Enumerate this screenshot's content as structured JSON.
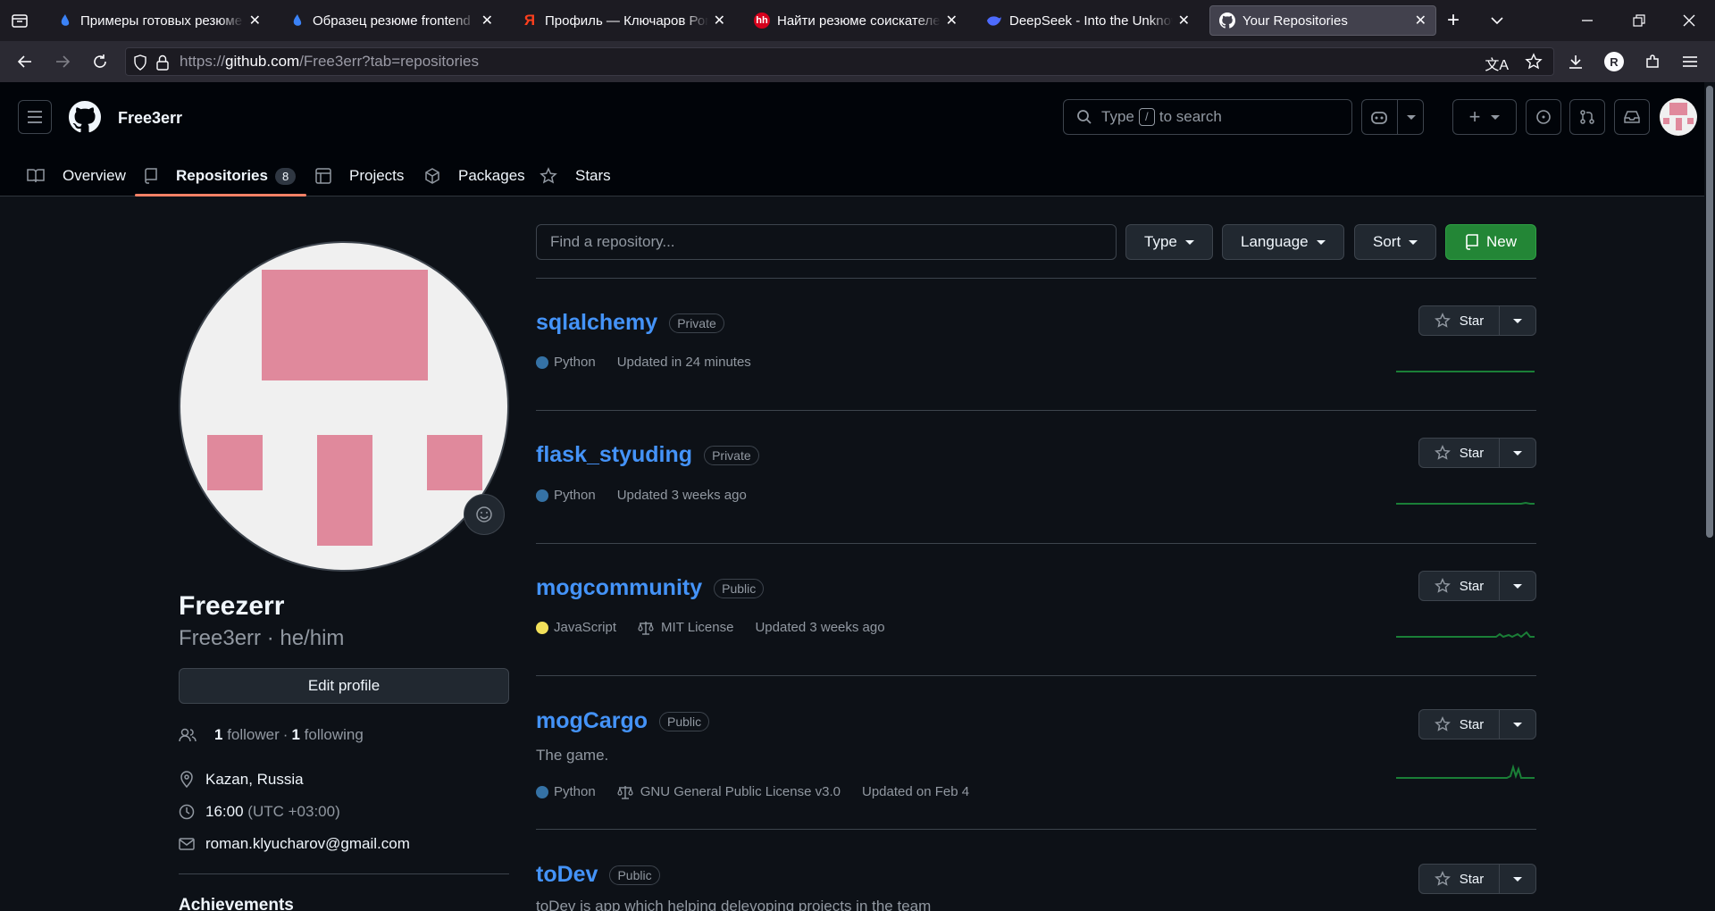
{
  "browser": {
    "tabs": [
      {
        "title": "Примеры готовых резюме",
        "favicon": "drop-icon",
        "color": "#3b82f6"
      },
      {
        "title": "Образец резюме frontend",
        "favicon": "drop-icon",
        "color": "#3b82f6"
      },
      {
        "title": "Профиль — Ключаров Ром",
        "favicon": "Я",
        "color": "#fc3f1d"
      },
      {
        "title": "Найти резюме соискателей",
        "favicon": "hh",
        "color": "#d6001c"
      },
      {
        "title": "DeepSeek - Into the Unknow",
        "favicon": "whale-icon",
        "color": "#4d6bfe"
      },
      {
        "title": "Your Repositories",
        "favicon": "github-icon",
        "color": "#ffffff"
      }
    ],
    "url_prefix": "https://",
    "url_host": "github.com",
    "url_path": "/Free3err?tab=repositories"
  },
  "header": {
    "username": "Free3err",
    "search_before": "Type",
    "search_key": "/",
    "search_after": "to search"
  },
  "profile_tabs": [
    {
      "label": "Overview",
      "icon": "book-icon"
    },
    {
      "label": "Repositories",
      "icon": "repo-icon",
      "count": "8",
      "selected": true
    },
    {
      "label": "Projects",
      "icon": "table-icon"
    },
    {
      "label": "Packages",
      "icon": "package-icon"
    },
    {
      "label": "Stars",
      "icon": "star-icon"
    }
  ],
  "sidebar": {
    "name": "Freezerr",
    "login_line": "Free3err · he/him",
    "edit_label": "Edit profile",
    "followers_count": "1",
    "followers_label": "follower",
    "sep": "·",
    "following_count": "1",
    "following_label": "following",
    "location": "Kazan, Russia",
    "time": "16:00",
    "timezone": "(UTC +03:00)",
    "email": "roman.klyucharov@gmail.com",
    "achievements": "Achievements",
    "avatar_color": "#e0899c"
  },
  "toolbar": {
    "find_placeholder": "Find a repository...",
    "type_label": "Type",
    "language_label": "Language",
    "sort_label": "Sort",
    "new_label": "New"
  },
  "star_label": "Star",
  "repos": [
    {
      "name": "sqlalchemy",
      "visibility": "Private",
      "description": "",
      "language": "Python",
      "lang_color": "#3572A5",
      "license": "",
      "updated": "Updated in 24 minutes"
    },
    {
      "name": "flask_styuding",
      "visibility": "Private",
      "description": "",
      "language": "Python",
      "lang_color": "#3572A5",
      "license": "",
      "updated": "Updated 3 weeks ago"
    },
    {
      "name": "mogcommunity",
      "visibility": "Public",
      "description": "",
      "language": "JavaScript",
      "lang_color": "#f1e05a",
      "license": "MIT License",
      "updated": "Updated 3 weeks ago"
    },
    {
      "name": "mogCargo",
      "visibility": "Public",
      "description": "The game.",
      "language": "Python",
      "lang_color": "#3572A5",
      "license": "GNU General Public License v3.0",
      "updated": "Updated on Feb 4"
    },
    {
      "name": "toDev",
      "visibility": "Public",
      "description": "toDev is app which helping delevoping projects in the team",
      "language": "",
      "lang_color": "",
      "license": "",
      "updated": ""
    }
  ]
}
